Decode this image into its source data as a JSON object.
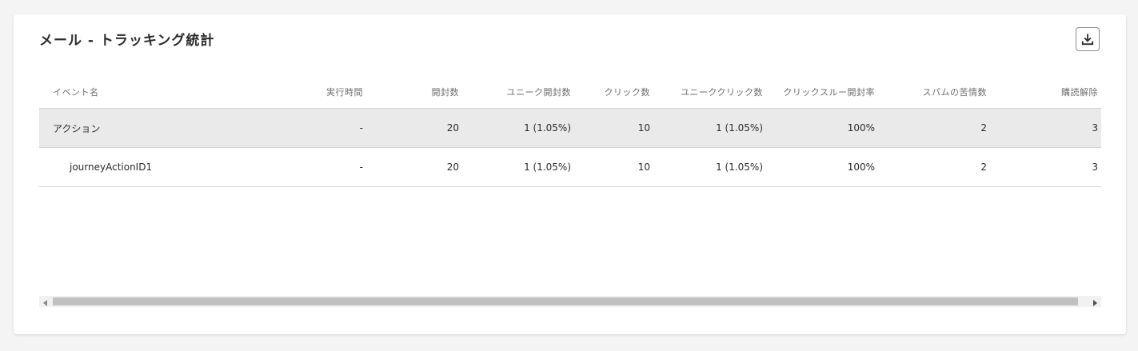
{
  "card": {
    "title": "メール - トラッキング統計"
  },
  "icons": {
    "download": "download-icon",
    "scroll_left": "arrow-left-icon",
    "scroll_right": "arrow-right-icon"
  },
  "table": {
    "columns": [
      "イベント名",
      "実行時間",
      "開封数",
      "ユニーク開封数",
      "クリック数",
      "ユニーククリック数",
      "クリックスルー開封率",
      "スパムの苦情数",
      "購読解除"
    ],
    "rows": [
      {
        "type": "group",
        "cells": [
          "アクション",
          "-",
          "20",
          "1 (1.05%)",
          "10",
          "1 (1.05%)",
          "100%",
          "2",
          "3"
        ]
      },
      {
        "type": "child",
        "cells": [
          "journeyActionID1",
          "-",
          "20",
          "1 (1.05%)",
          "10",
          "1 (1.05%)",
          "100%",
          "2",
          "3"
        ]
      }
    ]
  },
  "colors": {
    "background": "#f4f4f4",
    "card": "#ffffff",
    "group_row": "#eaeaea",
    "border": "#d3d3d3",
    "scroll_thumb": "#c1c1c1"
  }
}
